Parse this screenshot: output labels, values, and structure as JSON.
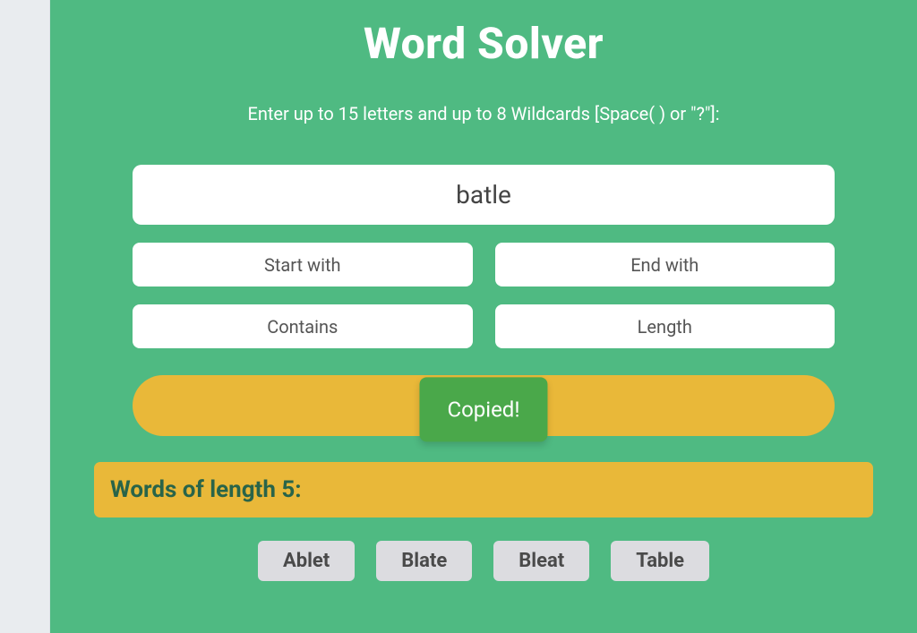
{
  "header": {
    "title": "Word Solver",
    "instructions": "Enter up to 15 letters and up to 8 Wildcards [Space( ) or \"?\"]:"
  },
  "form": {
    "letters_value": "batle",
    "start_with_placeholder": "Start with",
    "end_with_placeholder": "End with",
    "contains_placeholder": "Contains",
    "length_placeholder": "Length"
  },
  "toast": {
    "copied_label": "Copied!"
  },
  "results": {
    "heading": "Words of length 5:",
    "words": [
      "Ablet",
      "Blate",
      "Bleat",
      "Table"
    ]
  }
}
